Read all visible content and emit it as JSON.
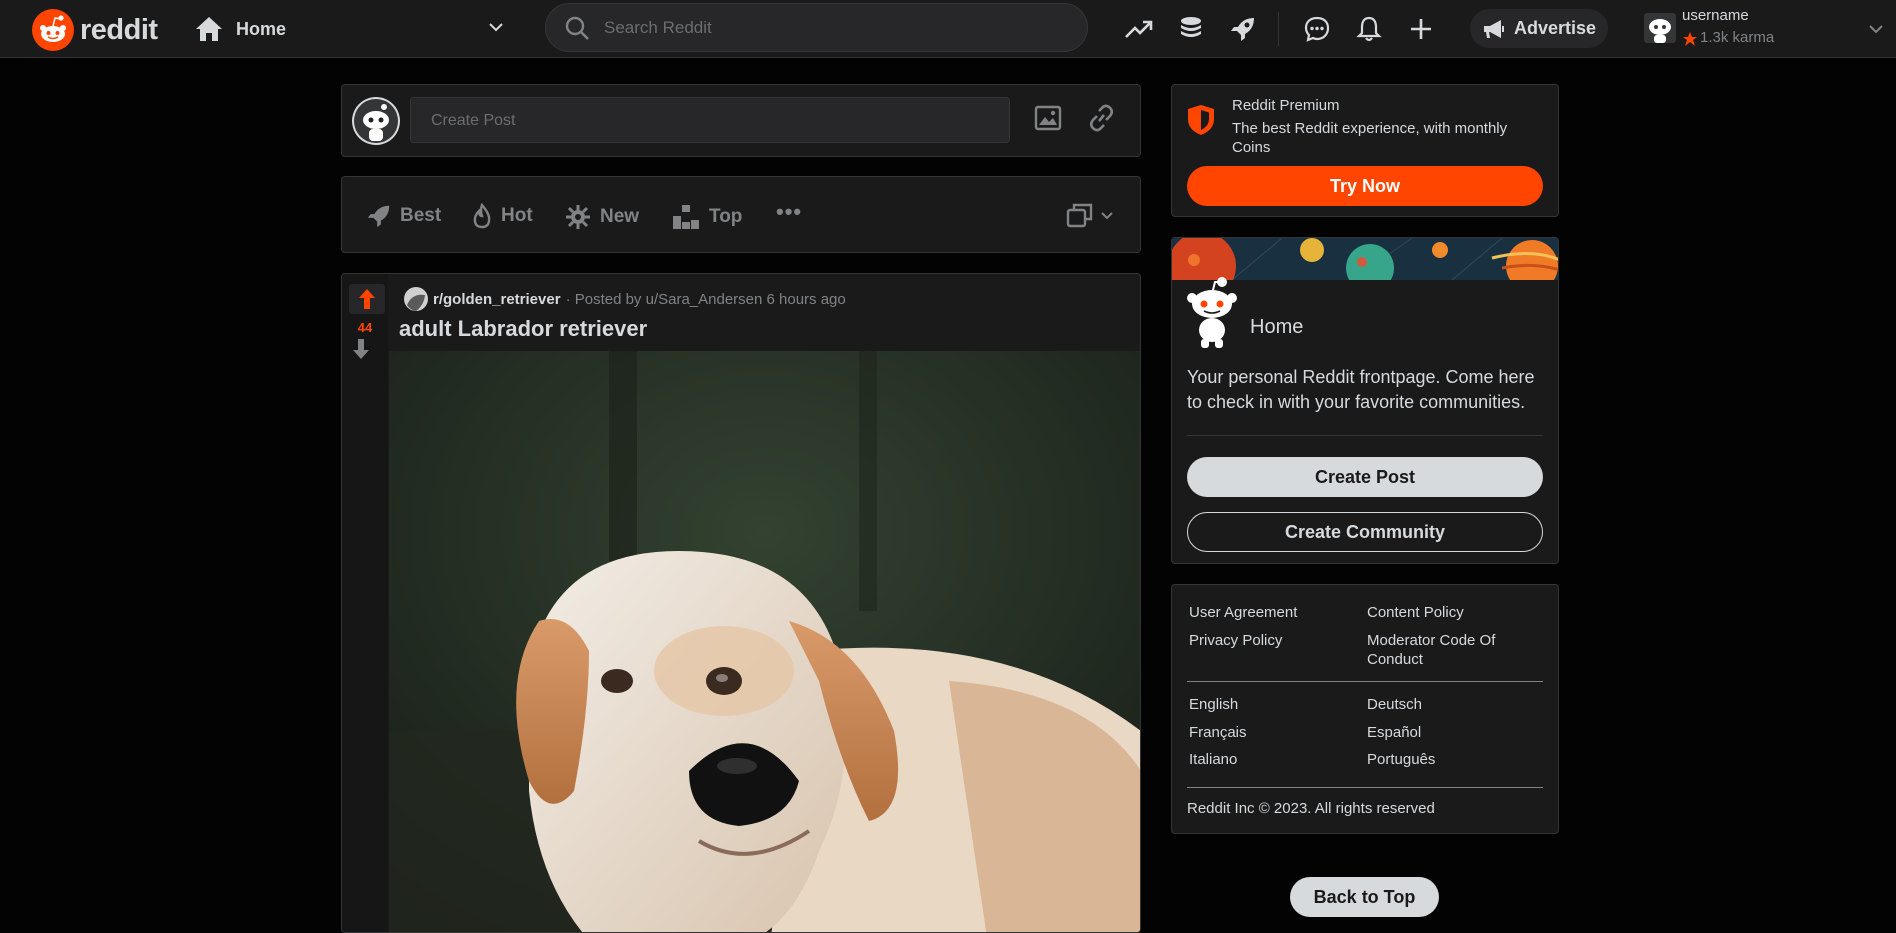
{
  "header": {
    "logo_text": "reddit",
    "home_label": "Home",
    "search_placeholder": "Search Reddit",
    "advertise_label": "Advertise",
    "username": "username",
    "karma": "1.3k karma"
  },
  "create_post": {
    "placeholder": "Create Post"
  },
  "sort": {
    "best": "Best",
    "hot": "Hot",
    "new": "New",
    "top": "Top",
    "more": "•••"
  },
  "post": {
    "subreddit": "r/golden_retriever",
    "posted_by": "· Posted by u/Sara_Andersen 6 hours ago",
    "score": "44",
    "title": "adult Labrador retriever"
  },
  "premium": {
    "title": "Reddit Premium",
    "description": "The best Reddit experience, with monthly Coins",
    "button": "Try Now"
  },
  "home_card": {
    "title": "Home",
    "description": "Your personal Reddit frontpage. Come here to check in with your favorite communities.",
    "create_post": "Create Post",
    "create_community": "Create Community"
  },
  "footer_links": {
    "user_agreement": "User Agreement",
    "content_policy": "Content Policy",
    "privacy_policy": "Privacy Policy",
    "moderator_code": "Moderator Code Of Conduct",
    "languages": [
      "English",
      "Deutsch",
      "Français",
      "Español",
      "Italiano",
      "Português"
    ],
    "copyright": "Reddit Inc © 2023. All rights reserved"
  },
  "back_to_top": "Back to Top",
  "colors": {
    "accent": "#ff4500",
    "bg": "#030303",
    "card": "#1a1a1b",
    "text": "#d7dadc",
    "muted": "#818384"
  }
}
